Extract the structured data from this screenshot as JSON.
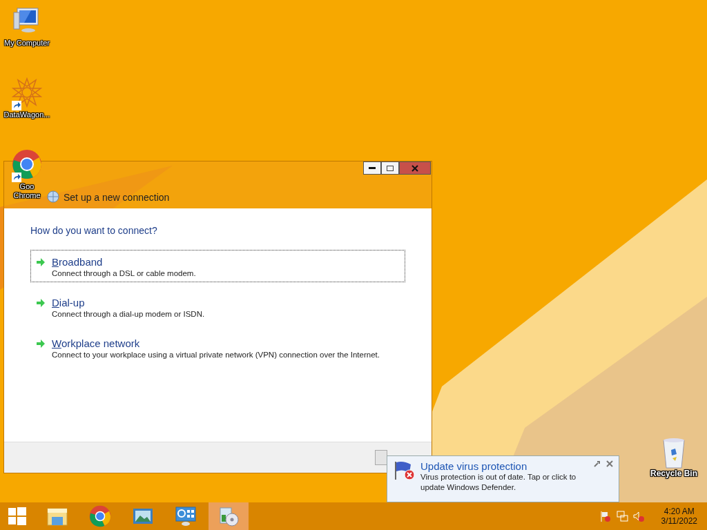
{
  "desktop_icons": [
    {
      "kind": "computer",
      "label": "My Computer",
      "shortcut": false
    },
    {
      "kind": "star",
      "label": "DataWagon...",
      "shortcut": true
    },
    {
      "kind": "chrome",
      "label": "Goo\nChrome",
      "shortcut": true
    }
  ],
  "recycle_bin": {
    "label": "Recycle Bin"
  },
  "dialog": {
    "title": "Set up a new connection",
    "heading": "How do you want to connect?",
    "options": [
      {
        "title": "Broadband",
        "description": "Connect through a DSL or cable modem.",
        "selected": true
      },
      {
        "title": "Dial-up",
        "description": "Connect through a dial-up modem or ISDN.",
        "selected": false
      },
      {
        "title": "Workplace network",
        "description": "Connect to your workplace using a virtual private network (VPN) connection over the Internet.",
        "selected": false
      }
    ]
  },
  "notification": {
    "title": "Update virus protection",
    "message": "Virus protection is out of date. Tap or click to update Windows Defender."
  },
  "taskbar": {
    "apps": [
      {
        "kind": "explorer",
        "active": false
      },
      {
        "kind": "chrome",
        "active": false
      },
      {
        "kind": "photos",
        "active": false
      },
      {
        "kind": "control",
        "active": false
      },
      {
        "kind": "installer",
        "active": true
      }
    ],
    "time": "4:20 AM",
    "date": "3/11/2022"
  }
}
